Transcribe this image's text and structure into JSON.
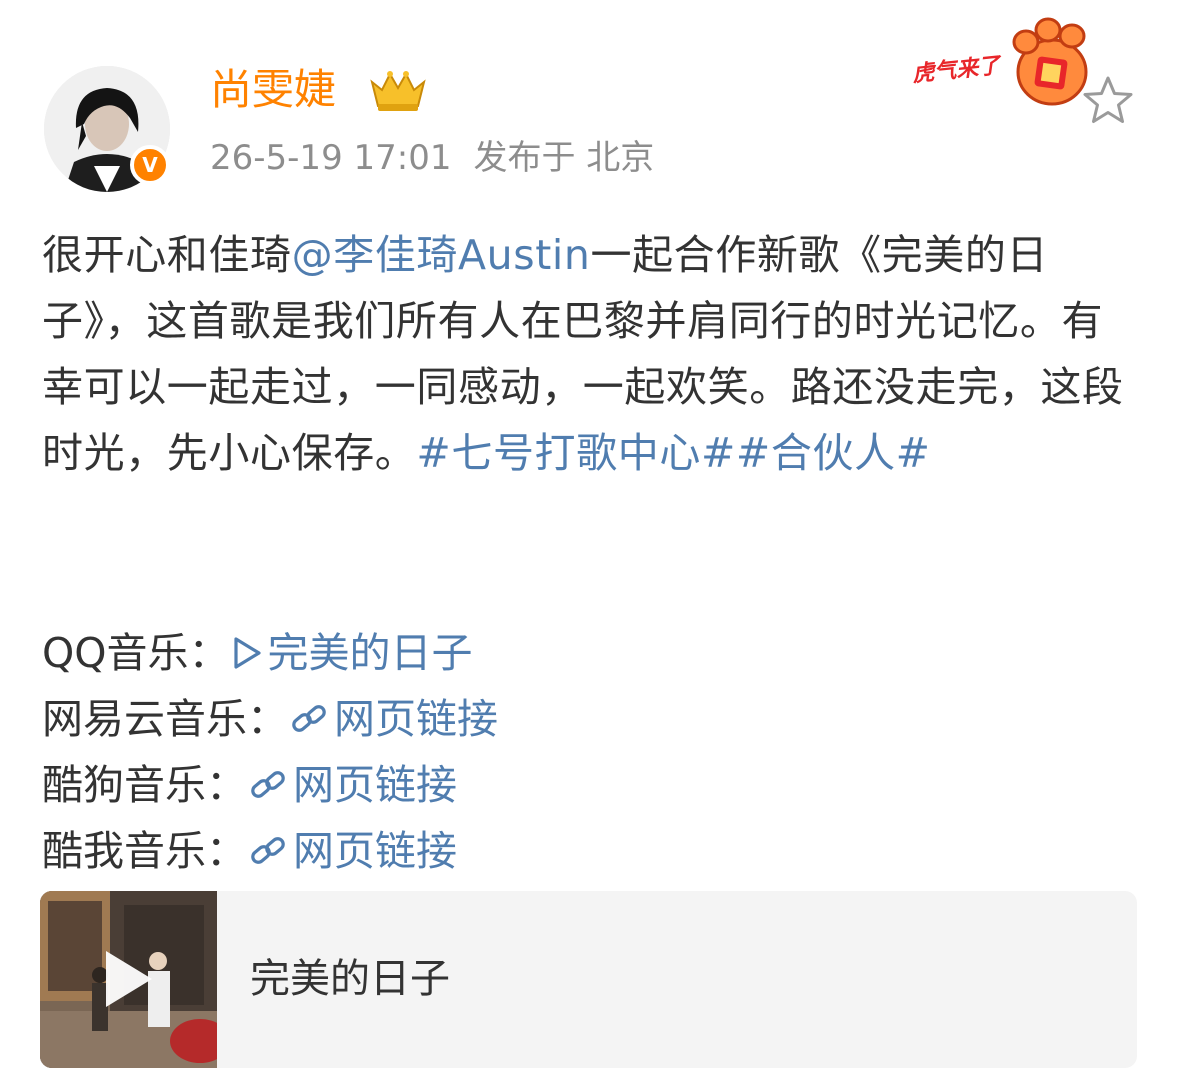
{
  "post": {
    "author": "尚雯婕",
    "timestamp": "26-5-19 17:01",
    "location": "发布于 北京",
    "verified_icon": "V",
    "sticker_text": "虎气来了"
  },
  "content": {
    "p1": "很开心和佳琦",
    "mention": "@李佳琦Austin",
    "p2": "一起合作新歌《完美的日子》，这首歌是我们所有人在巴黎并肩同行的时光记忆。有幸可以一起走过，一同感动，一起欢笑。路还没走完，这段时光，先小心保存。",
    "tag1": "#七号打歌中心#",
    "tag2": "#合伙人#"
  },
  "music_links": [
    {
      "label": "QQ音乐：",
      "link": "完美的日子",
      "icon": "play-icon"
    },
    {
      "label": "网易云音乐：",
      "link": "网页链接",
      "icon": "link-icon"
    },
    {
      "label": "酷狗音乐：",
      "link": "网页链接",
      "icon": "link-icon"
    },
    {
      "label": "酷我音乐：",
      "link": "网页链接",
      "icon": "link-icon"
    }
  ],
  "card": {
    "title": "完美的日子"
  },
  "colors": {
    "accent_orange": "#ff8200",
    "link_blue": "#507daf",
    "meta_gray": "#8d8d8d",
    "text": "#333333"
  }
}
